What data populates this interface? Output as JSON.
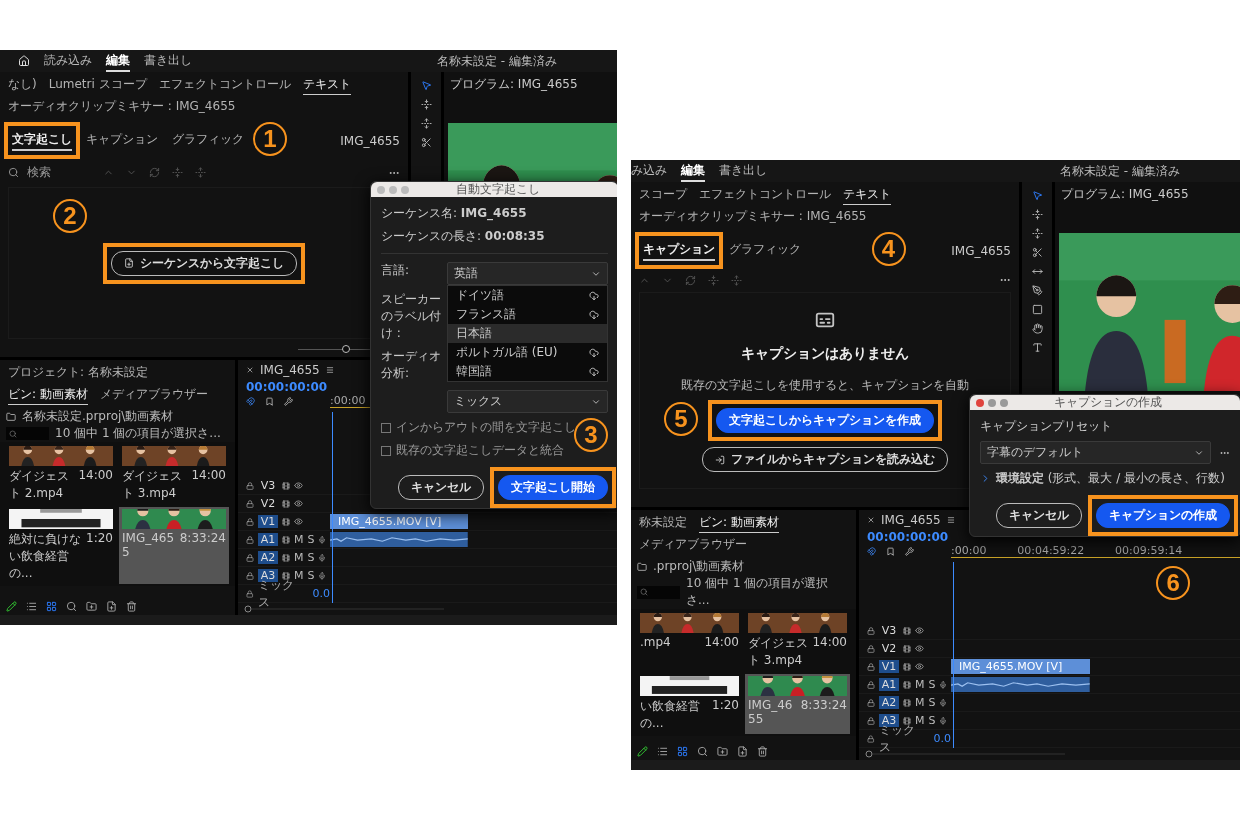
{
  "screens": [
    {
      "home": true,
      "menu": [
        {
          "label": "読み込み",
          "selected": false
        },
        {
          "label": "編集",
          "selected": true
        },
        {
          "label": "書き出し",
          "selected": false
        }
      ],
      "title": "名称未設定 - 編集済み",
      "panel_tabs": [
        {
          "label": "なし)",
          "selected": false
        },
        {
          "label": "Lumetri スコープ",
          "selected": false
        },
        {
          "label": "エフェクトコントロール",
          "selected": false
        },
        {
          "label": "テキスト",
          "selected": true
        },
        {
          "label": "オーディオクリップミキサー : IMG_4655",
          "selected": false
        }
      ],
      "sub_tabs": [
        {
          "label": "文字起こし",
          "selected": true
        },
        {
          "label": "キャプション",
          "selected": false
        },
        {
          "label": "グラフィック",
          "selected": false
        }
      ],
      "sequence": "IMG_4655",
      "search": {
        "placeholder": "検索"
      },
      "body": {
        "kind": "transcript",
        "button": "シーケンスから文字起こし"
      },
      "zoom": {
        "level": 0.6
      },
      "program": "プログラム: IMG_4655",
      "project": {
        "tabs": [
          {
            "label": "プロジェクト: 名称未設定",
            "selected": false
          },
          {
            "label": "ビン: 動画素材",
            "selected": true
          },
          {
            "label": "メディアブラウザー",
            "selected": false
          }
        ],
        "path": "名称未設定.prproj\\動画素材",
        "count": "10 個中 1 個の項目が選択さ...",
        "clips": [
          {
            "name": "ダイジェスト 2.mp4",
            "duration": "14:00",
            "selected": false
          },
          {
            "name": "ダイジェスト 3.mp4",
            "duration": "14:00",
            "selected": false
          },
          {
            "name": "絶対に負けない飲食経営の...",
            "duration": "1:20",
            "selected": false
          },
          {
            "name": "IMG_4655",
            "duration": "8:33:24",
            "selected": true
          }
        ]
      },
      "timeline": {
        "sequence": "IMG_4655",
        "timecode": "00:00:00:00",
        "ticks": [
          ":00:00"
        ],
        "tracks": [
          {
            "kind": "video",
            "label": "V3",
            "targeted": false
          },
          {
            "kind": "video",
            "label": "V2",
            "targeted": false
          },
          {
            "kind": "video",
            "label": "V1",
            "targeted": true,
            "clip": "IMG_4655.MOV [V]"
          },
          {
            "kind": "audio",
            "label": "A1",
            "targeted": true,
            "mute": "M",
            "solo": "S",
            "waveform": true
          },
          {
            "kind": "audio",
            "label": "A2",
            "targeted": true,
            "mute": "M",
            "solo": "S",
            "waveform": false
          },
          {
            "kind": "audio",
            "label": "A3",
            "targeted": true,
            "mute": "M",
            "solo": "S",
            "waveform": false
          },
          {
            "kind": "mix",
            "label": "ミックス",
            "value": "0.0"
          }
        ]
      },
      "dialog": {
        "kind": "transcribe",
        "title": "自動文字起こし",
        "info": [
          "シーケンス名: **IMG_4655**",
          "シーケンスの長さ: **00:08:35**"
        ],
        "language_label": "言語:",
        "language": "英語",
        "options": [
          {
            "label": "ドイツ語",
            "download": true,
            "selected": false
          },
          {
            "label": "フランス語",
            "download": true,
            "selected": false
          },
          {
            "label": "日本語",
            "download": false,
            "selected": true
          },
          {
            "label": "ポルトガル語 (EU)",
            "download": true,
            "selected": false
          },
          {
            "label": "韓国語",
            "download": true,
            "selected": false
          }
        ],
        "speaker_label": "スピーカーのラベル付け :",
        "audio_label": "オーディオ分析:",
        "audio": "ミックス",
        "checkboxes": [
          {
            "label": "インからアウトの間を文字起こし",
            "checked": false
          },
          {
            "label": "既存の文字起こしデータと統合",
            "checked": false
          }
        ],
        "buttons": [
          {
            "label": "キャンセル",
            "primary": false
          },
          {
            "label": "文字起こし開始",
            "primary": true
          }
        ]
      }
    },
    {
      "home": false,
      "menu": [
        {
          "label": "み込み",
          "selected": false
        },
        {
          "label": "編集",
          "selected": true
        },
        {
          "label": "書き出し",
          "selected": false
        }
      ],
      "title": "名称未設定 - 編集済み",
      "panel_tabs": [
        {
          "label": "スコープ",
          "selected": false
        },
        {
          "label": "エフェクトコントロール",
          "selected": false
        },
        {
          "label": "テキスト",
          "selected": true
        },
        {
          "label": "オーディオクリップミキサー : IMG_4655",
          "selected": false
        }
      ],
      "sub_tabs": [
        {
          "label": "キャプション",
          "selected": true
        },
        {
          "label": "グラフィック",
          "selected": false
        }
      ],
      "sequence": "IMG_4655",
      "body": {
        "kind": "captions",
        "heading": "キャプションはありません",
        "description": "既存の文字起こしを使用すると、キャプションを自動",
        "buttons": [
          {
            "label": "文字起こしからキャプションを作成",
            "primary": true
          },
          {
            "label": "ファイルからキャプションを読み込む",
            "primary": false
          }
        ]
      },
      "program": "プログラム: IMG_4655",
      "project": {
        "tabs": [
          {
            "label": "称未設定",
            "selected": false
          },
          {
            "label": "ビン: 動画素材",
            "selected": true
          },
          {
            "label": "メディアブラウザー",
            "selected": false
          }
        ],
        "path": ".prproj\\動画素材",
        "count": "10 個中 1 個の項目が選択さ...",
        "clips": [
          {
            "name": ".mp4",
            "duration": "14:00",
            "selected": false
          },
          {
            "name": "ダイジェスト 3.mp4",
            "duration": "14:00",
            "selected": false
          },
          {
            "name": "い飲食経営の...",
            "duration": "1:20",
            "selected": false
          },
          {
            "name": "IMG_4655",
            "duration": "8:33:24",
            "selected": true
          }
        ]
      },
      "timeline": {
        "sequence": "IMG_4655",
        "timecode": "00:00:00:00",
        "ticks": [
          ":00:00",
          "00:04:59:22",
          "00:09:59:14"
        ],
        "tracks": [
          {
            "kind": "video",
            "label": "V3",
            "targeted": false
          },
          {
            "kind": "video",
            "label": "V2",
            "targeted": false
          },
          {
            "kind": "video",
            "label": "V1",
            "targeted": true,
            "clip": "IMG_4655.MOV [V]"
          },
          {
            "kind": "audio",
            "label": "A1",
            "targeted": true,
            "mute": "M",
            "solo": "S",
            "waveform": true
          },
          {
            "kind": "audio",
            "label": "A2",
            "targeted": true,
            "mute": "M",
            "solo": "S",
            "waveform": false
          },
          {
            "kind": "audio",
            "label": "A3",
            "targeted": true,
            "mute": "M",
            "solo": "S",
            "waveform": false
          },
          {
            "kind": "mix",
            "label": "ミックス",
            "value": "0.0"
          }
        ]
      },
      "dialog": {
        "kind": "caption",
        "title": "キャプションの作成",
        "preset_label": "キャプションプリセット",
        "preset": "字幕のデフォルト",
        "settings": "**環境設定** (形式、最大 / 最小の長さ、行数)",
        "buttons": [
          {
            "label": "キャンセル",
            "primary": false
          },
          {
            "label": "キャプションの作成",
            "primary": true
          }
        ]
      }
    }
  ],
  "annotations": [
    {
      "number": "1"
    },
    {
      "number": "2"
    },
    {
      "number": "3"
    },
    {
      "number": "4"
    },
    {
      "number": "5"
    },
    {
      "number": "6"
    }
  ]
}
